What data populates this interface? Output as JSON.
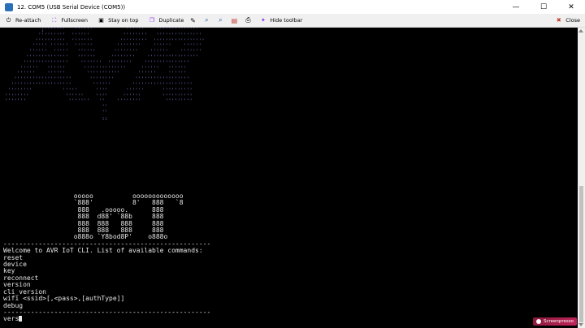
{
  "window": {
    "title": "12. COM5  (USB Serial Device (COM5))",
    "minimize": "—",
    "maximize": "☐",
    "close": "✕"
  },
  "toolbar": {
    "reattach": "Re-attach",
    "fullscreen": "Fullscreen",
    "stay_on_top": "Stay on top",
    "duplicate": "Duplicate",
    "hide_toolbar": "Hide toolbar",
    "close": "Close"
  },
  "terminal": {
    "banner_art": "            ;'''''''   ''''''           ''''''    ''''''''''''''\n           '''''''''  ''''''           ''''''''   '''''''''''''''\n          ''''''''''  '''''''         '''''''''  '''''''''''''''''\n         ''''' ''''''  ''''''        ''''''''    ''''''    ''''''\n        ''''''  '''''   ''''''      ''''''''    ''''''    '''''''\n       ''''''''''''''   ''''''     ''''''''    '''''''''''''''''\n      '''''''''''''''    '''''''  ''''''''    '''''''''''''''\n     ''''''   ''''''      ''''''''''''''     ''''''   ''''''\n    ''''''    ''''''       '''''''''''      ''''''    ''''''\n   '''''''''''''''''''      ''''''''       ''''''''''''''''''\n  ''''''''''''''''''''       ''''''       ''''''''''''''''''''\n ''''''''          '''''      ''''      ''''''      ''''''''''\n''''''''            ''''''    ''''     ''''''       ''''''''''\n'''''''              '''''''   ''    ''''''''        '''''''''\n                                ''\n                                ''\n                                ;;",
    "logo_lines": "                  ooooo          ooooooooooooo\n                  `888'          8'   888   `8\n                   888   .ooooo.      888\n                   888  d88' `88b     888\n                   888  888   888     888\n                   888  888   888     888\n                  o888o `Y8bod8P'    o888o",
    "separator": "-----------------------------------------------------",
    "welcome": "Welcome to AVR IoT CLI. List of available commands:",
    "commands": [
      "reset",
      "device",
      "key",
      "reconnect",
      "version",
      "cli_version",
      "wifi <ssid>[,<pass>,[authType]]",
      "debug"
    ],
    "prompt_input": "vers"
  },
  "watermark": {
    "text": "Screenpresso"
  },
  "colors": {
    "art": "#7a78c9",
    "text": "#e6e6e6",
    "background": "#000000"
  }
}
